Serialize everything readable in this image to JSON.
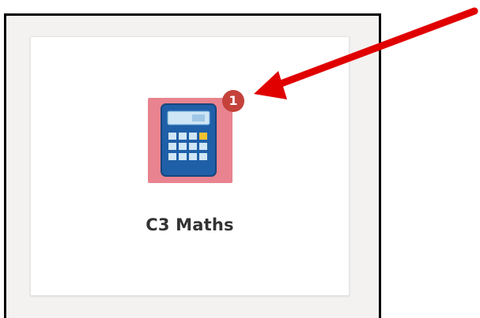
{
  "tile": {
    "title": "C3 Maths",
    "badge_count": "1",
    "icon": "calculator-icon",
    "icon_bg_color": "#e8838f",
    "badge_color": "#c4423a"
  },
  "annotation": {
    "arrow_color": "#e00000"
  }
}
